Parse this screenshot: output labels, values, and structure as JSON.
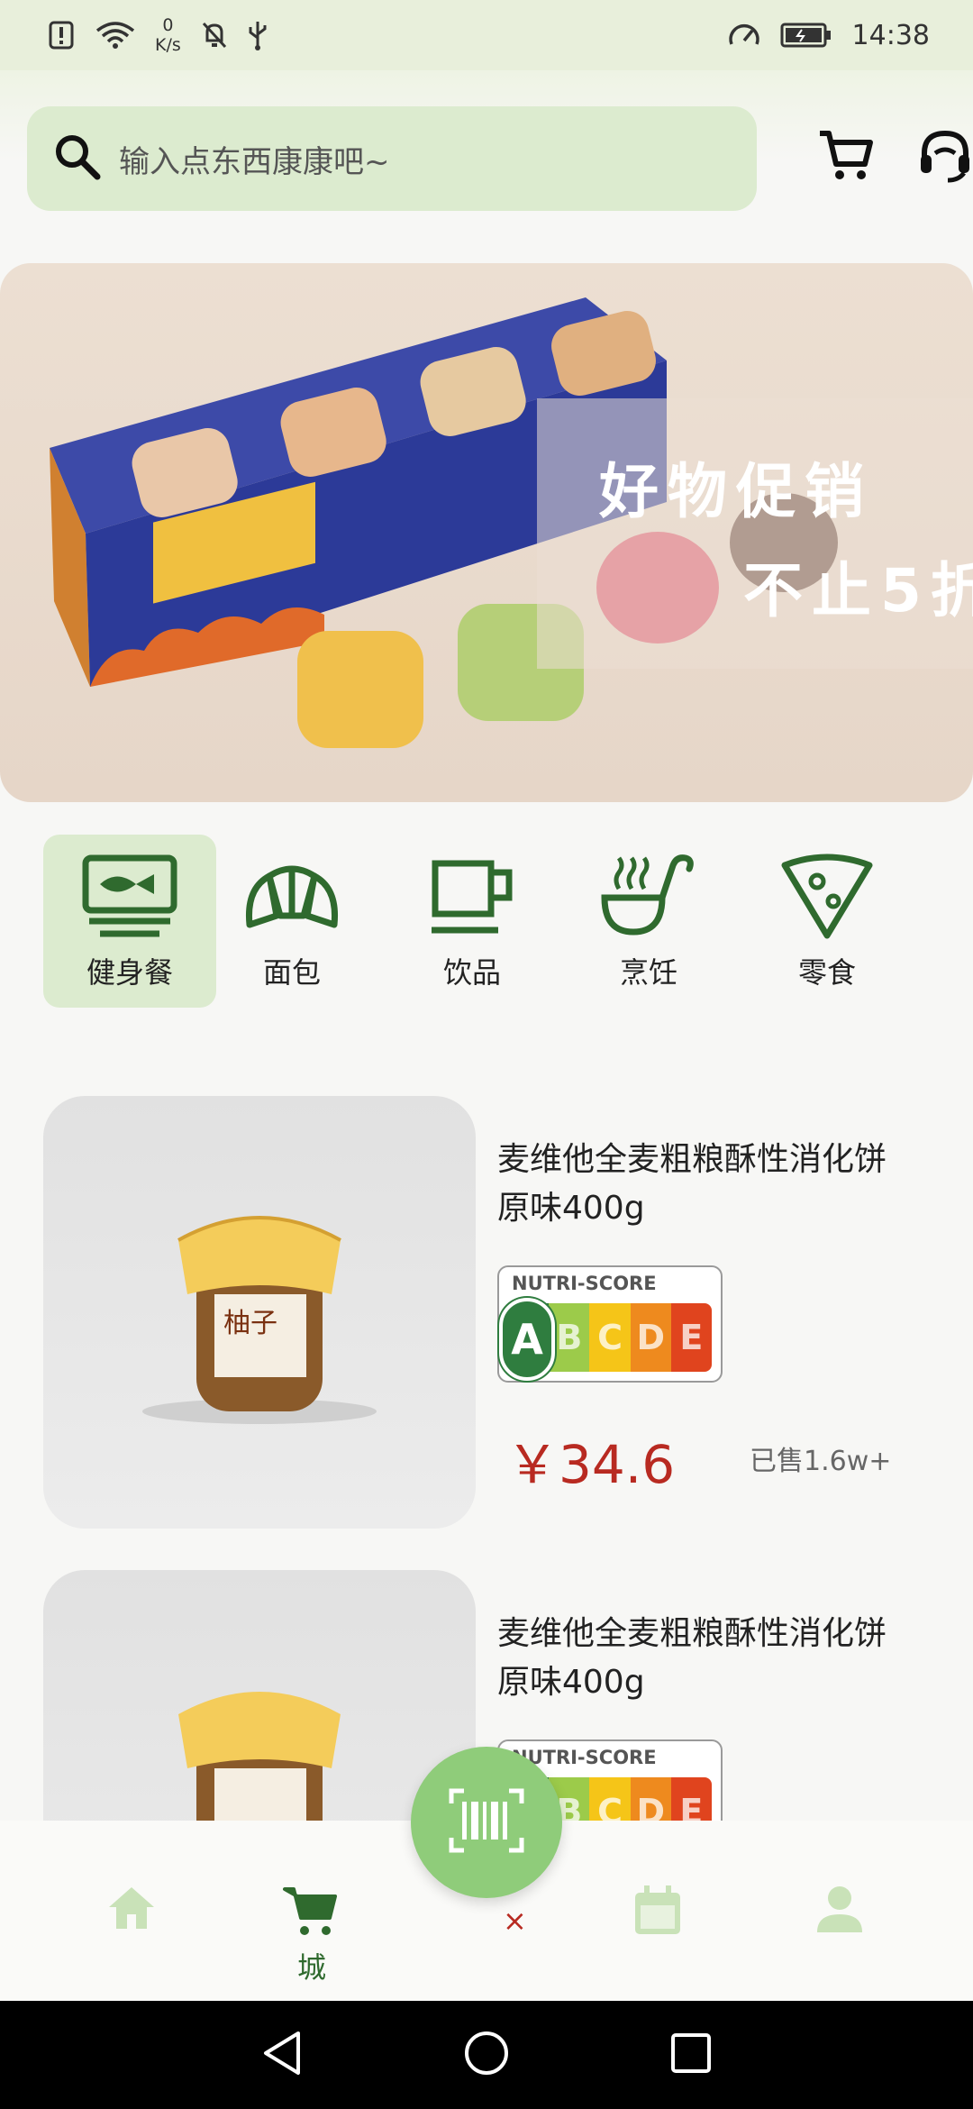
{
  "status_bar": {
    "net_speed_value": "0",
    "net_speed_unit": "K/s",
    "time": "14:38"
  },
  "search": {
    "placeholder": "输入点东西康康吧~"
  },
  "banner": {
    "line1": "好物促销",
    "line2": "不止5折"
  },
  "categories": [
    {
      "label": "健身餐",
      "icon": "fish-plate-icon",
      "active": true
    },
    {
      "label": "面包",
      "icon": "croissant-icon",
      "active": false
    },
    {
      "label": "饮品",
      "icon": "cup-icon",
      "active": false
    },
    {
      "label": "烹饪",
      "icon": "ladle-icon",
      "active": false
    },
    {
      "label": "零食",
      "icon": "pizza-slice-icon",
      "active": false
    }
  ],
  "products": [
    {
      "title": "麦维他全麦粗粮酥性消化饼原味400g",
      "nutri_title": "NUTRI-SCORE",
      "nutri_grades": [
        "A",
        "B",
        "C",
        "D",
        "E"
      ],
      "nutri_selected": "A",
      "price": "￥34.6",
      "sold": "已售1.6w+"
    },
    {
      "title": "麦维他全麦粗粮酥性消化饼原味400g",
      "nutri_title": "NUTRI-SCORE",
      "nutri_grades": [
        "A",
        "B",
        "C",
        "D",
        "E"
      ],
      "price": "",
      "sold": ""
    }
  ],
  "bottom_nav": {
    "items": [
      {
        "icon": "home-icon",
        "label": ""
      },
      {
        "icon": "cart-icon",
        "label": "城"
      },
      {
        "icon": "calendar-icon",
        "label": ""
      },
      {
        "icon": "user-icon",
        "label": ""
      }
    ]
  },
  "colors": {
    "accent_green": "#2f6a2e",
    "light_green": "#dcebcf",
    "price_red": "#b82a21",
    "scan_green": "#8fcc7a"
  }
}
